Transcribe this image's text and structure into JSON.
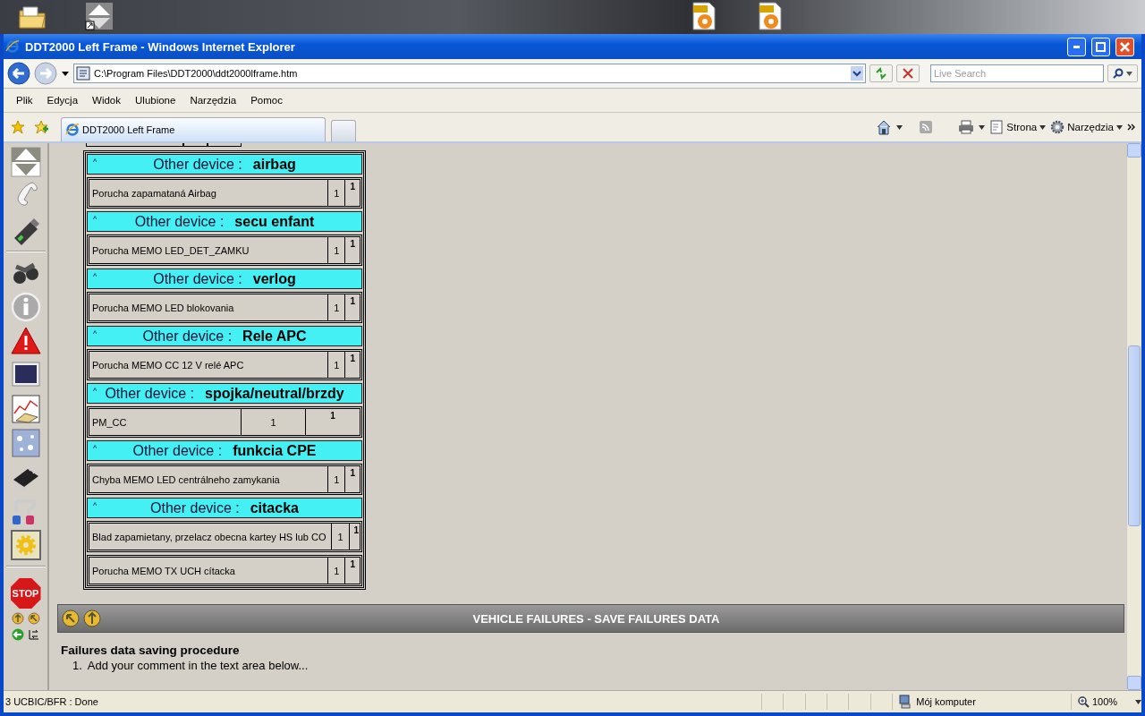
{
  "window": {
    "title": "DDT2000 Left Frame - Windows Internet Explorer"
  },
  "address_bar": {
    "value": "C:\\Program Files\\DDT2000\\ddt2000lframe.htm"
  },
  "search": {
    "placeholder": "Live Search"
  },
  "menu": [
    "Plik",
    "Edycja",
    "Widok",
    "Ulubione",
    "Narzędzia",
    "Pomoc"
  ],
  "tabs": [
    {
      "label": "DDT2000 Left Frame",
      "selected": true
    }
  ],
  "command_bar": [
    "Strona",
    "Narzędzia"
  ],
  "side_toolbar": {
    "stop_label": "STOP"
  },
  "devices": [
    {
      "caret": "^",
      "label": "Other device :",
      "name": "airbag",
      "rows": [
        {
          "text": "Porucha zapamataná Airbag",
          "count": "1",
          "flag": "1"
        }
      ]
    },
    {
      "caret": "^",
      "label": "Other device :",
      "name": "secu enfant",
      "rows": [
        {
          "text": "Porucha MEMO LED_DET_ZAMKU",
          "count": "1",
          "flag": "1"
        }
      ]
    },
    {
      "caret": "^",
      "label": "Other device :",
      "name": "verlog",
      "rows": [
        {
          "text": "Porucha MEMO LED blokovania",
          "count": "1",
          "flag": "1"
        }
      ]
    },
    {
      "caret": "^",
      "label": "Other device :",
      "name": "Rele APC",
      "rows": [
        {
          "text": "Porucha MEMO CC 12 V relé APC",
          "count": "1",
          "flag": "1"
        }
      ]
    },
    {
      "caret": "^",
      "label": "Other device :",
      "name": "spojka/neutral/brzdy",
      "rows": [
        {
          "text": "PM_CC",
          "count": "1",
          "flag": "1"
        }
      ]
    },
    {
      "caret": "^",
      "label": "Other device :",
      "name": "funkcia CPE",
      "rows": [
        {
          "text": "Chyba MEMO LED centrálneho zamykania",
          "count": "1",
          "flag": "1"
        }
      ]
    },
    {
      "caret": "^",
      "label": "Other device :",
      "name": "citacka",
      "rows": [
        {
          "text": "Blad zapamietany, przelacz obecna kartey HS lub CO",
          "count": "1",
          "flag": "1"
        },
        {
          "text": "Porucha MEMO TX UCH cítacka",
          "count": "1",
          "flag": "1"
        }
      ]
    }
  ],
  "section": {
    "title": "VEHICLE FAILURES - SAVE FAILURES DATA",
    "heading": "Failures data saving procedure",
    "steps": [
      {
        "number": "1.",
        "text": "Add your comment in the text area below..."
      }
    ]
  },
  "status_bar": {
    "text": "3 UCBIC/BFR : Done",
    "zone": "Mój komputer",
    "zoom": "100%"
  }
}
